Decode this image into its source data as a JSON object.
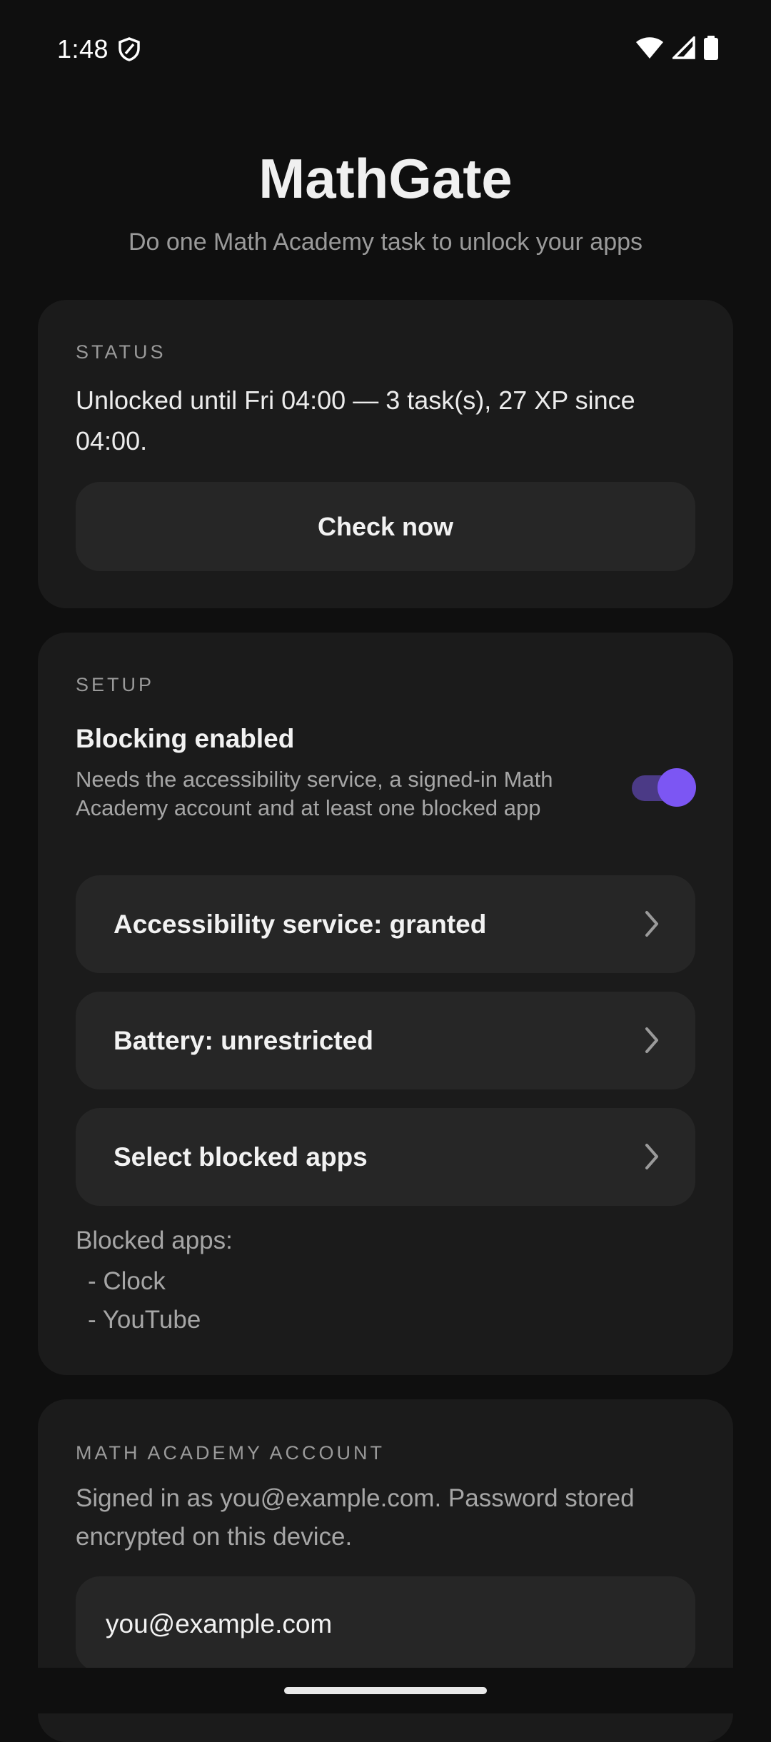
{
  "statusbar": {
    "time": "1:48",
    "icons": [
      "shield-icon",
      "wifi-icon",
      "signal-icon",
      "battery-icon"
    ]
  },
  "header": {
    "title": "MathGate",
    "subtitle": "Do one Math Academy task to unlock your apps"
  },
  "status": {
    "label": "STATUS",
    "text": "Unlocked until Fri 04:00 — 3 task(s), 27 XP since 04:00.",
    "check_button": "Check now"
  },
  "setup": {
    "label": "SETUP",
    "blocking_title": "Blocking enabled",
    "blocking_desc": "Needs the accessibility service, a signed-in Math Academy account and at least one blocked app",
    "blocking_on": true,
    "rows": [
      {
        "label": "Accessibility service: granted"
      },
      {
        "label": "Battery: unrestricted"
      },
      {
        "label": "Select blocked apps"
      }
    ],
    "blocked_title": "Blocked apps:",
    "blocked_apps": [
      "- Clock",
      "- YouTube"
    ]
  },
  "account": {
    "label": "MATH ACADEMY ACCOUNT",
    "text": "Signed in as you@example.com. Password stored encrypted on this device.",
    "email_value": "you@example.com"
  },
  "colors": {
    "background": "#0f0f0f",
    "card": "#1b1b1b",
    "button": "#262626",
    "accent": "#7c56f3",
    "accent_track": "#4b3a86"
  }
}
